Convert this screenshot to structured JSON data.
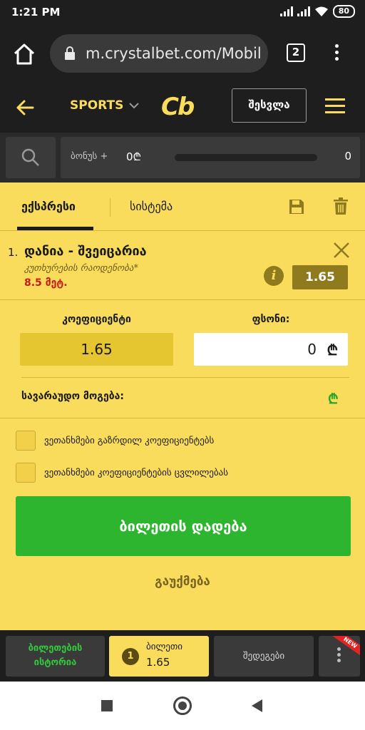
{
  "status_bar": {
    "time": "1:21 PM",
    "battery": "80"
  },
  "browser": {
    "url": "m.crystalbet.com/Mobil",
    "tab_count": "2"
  },
  "header": {
    "sports_label": "SPORTS",
    "logo_text": "Cb",
    "login_label": "შესვლა"
  },
  "bonus": {
    "label": "ბონუს +",
    "amount": "0₾",
    "count": "0",
    "progress": 0
  },
  "tabs": {
    "express": "ექსპრესი",
    "system": "სისტემა"
  },
  "bet": {
    "index": "1.",
    "match": "დანია - შვეიცარია",
    "market": "კუთხურების რაოდენობა*",
    "selection": "8.5 მეტ.",
    "odd": "1.65",
    "info_icon": "i"
  },
  "slip": {
    "coef_label": "კოეფიციენტი",
    "stake_label": "ფსონი:",
    "coef_value": "1.65",
    "stake_value": "0",
    "currency": "₾",
    "win_label": "სავარაუდო მოგება:",
    "win_currency": "₾"
  },
  "options": {
    "accept_increased": "ვეთანხმები გაზრდილ კოეფიციენტებს",
    "accept_change": "ვეთანხმები კოეფიციენტების ცვლილებას"
  },
  "actions": {
    "place_bet": "ბილეთის დადება",
    "cancel": "გაუქმება"
  },
  "bottom_bar": {
    "history_line1": "ბილეთების",
    "history_line2": "ისტორია",
    "ticket_count": "1",
    "ticket_label": "ბილეთი",
    "ticket_odd": "1.65",
    "results": "შედეგები",
    "new_tag": "NEW"
  },
  "colors": {
    "accent": "#f9dc5c",
    "dark": "#1e1e1e",
    "green": "#2db52f",
    "odd_badge": "#8f7a1e",
    "red": "#c41a1a"
  }
}
